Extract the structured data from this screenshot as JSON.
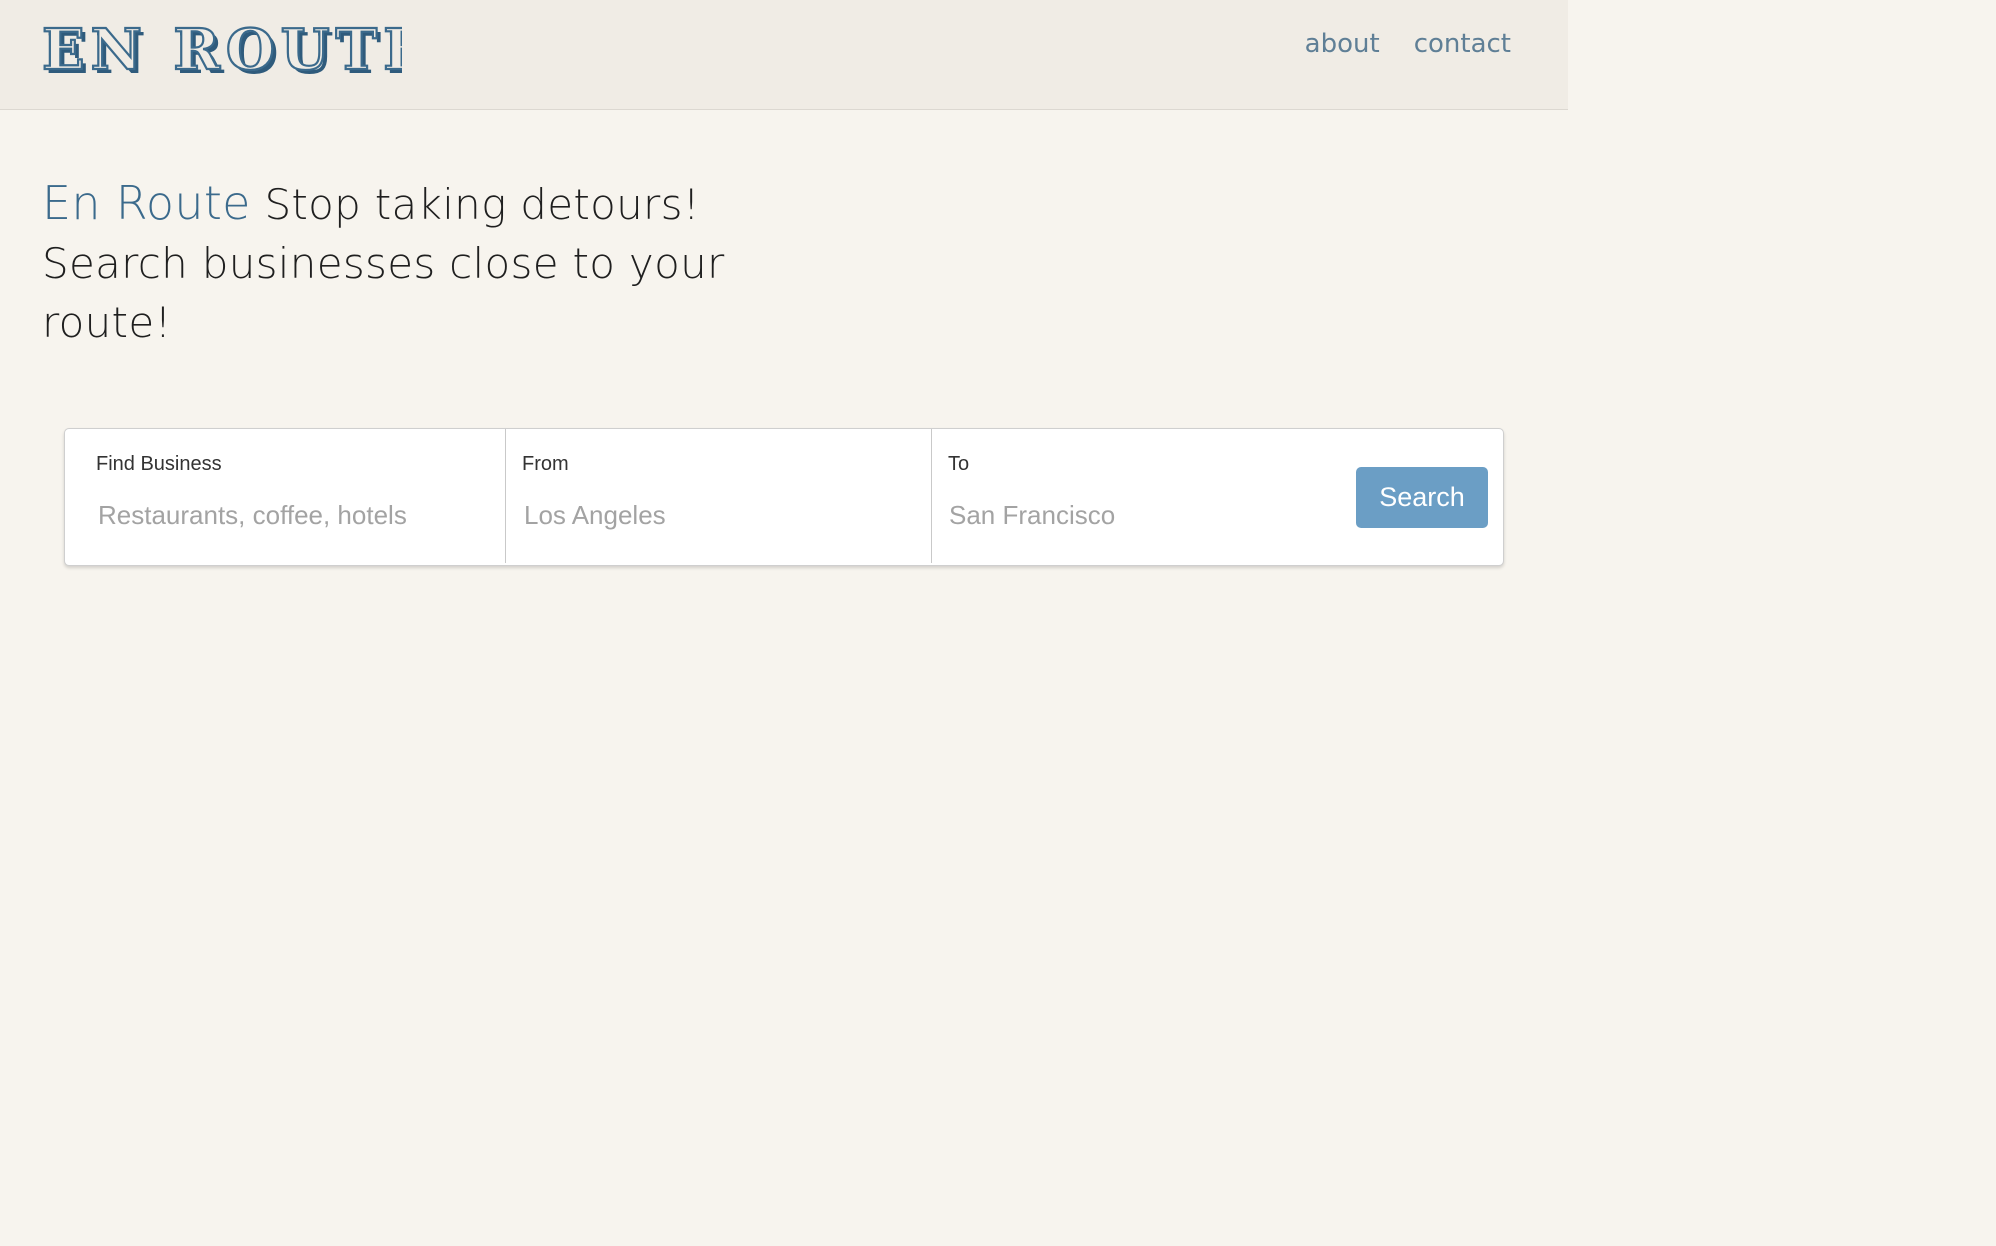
{
  "header": {
    "logo_text": "EN ROUTE",
    "nav": {
      "about": "about",
      "contact": "contact"
    }
  },
  "hero": {
    "brand": "En Route",
    "tagline": "Stop taking detours!",
    "subtitle": "Search businesses close to your route!"
  },
  "search": {
    "business": {
      "label": "Find Business",
      "placeholder": "Restaurants, coffee, hotels",
      "value": ""
    },
    "from": {
      "label": "From",
      "placeholder": "Los Angeles",
      "value": ""
    },
    "to": {
      "label": "To",
      "placeholder": "San Francisco",
      "value": ""
    },
    "button_label": "Search"
  },
  "colors": {
    "brand_blue": "#3b6a8c",
    "nav_text": "#5f7f96",
    "button_bg": "#6b9ec5",
    "page_bg": "#f7f4ee",
    "header_bg": "#f0ece5"
  }
}
